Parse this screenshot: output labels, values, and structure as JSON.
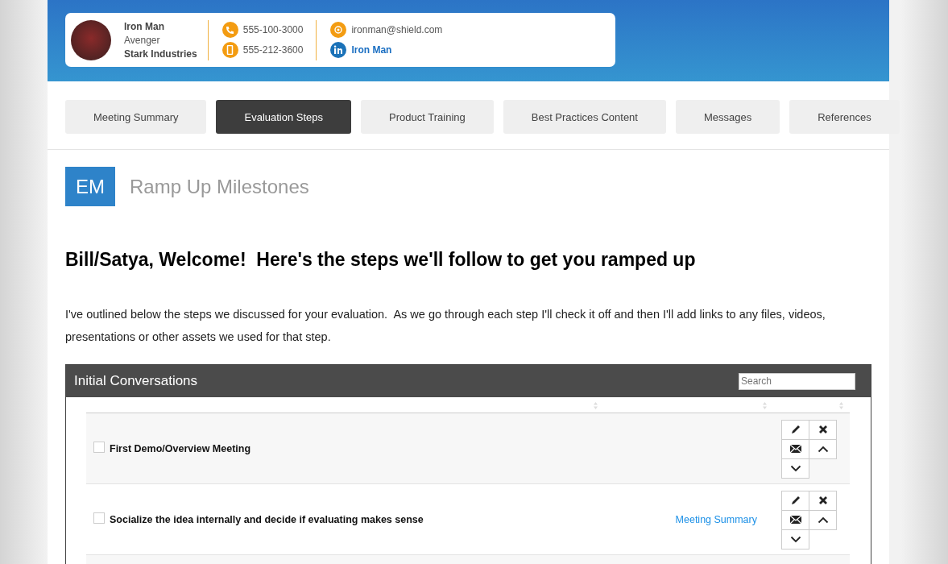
{
  "contact": {
    "name": "Iron Man",
    "title": "Avenger",
    "company": "Stark Industries",
    "phone": "555-100-3000",
    "mobile": "555-212-3600",
    "email": "ironman@shield.com",
    "linkedin": "Iron Man"
  },
  "tabs": [
    {
      "label": "Meeting Summary",
      "selected": false
    },
    {
      "label": "Evaluation Steps",
      "selected": true
    },
    {
      "label": "Product Training",
      "selected": false
    },
    {
      "label": "Best Practices Content",
      "selected": false
    },
    {
      "label": "Messages",
      "selected": false
    },
    {
      "label": "References",
      "selected": false
    }
  ],
  "page": {
    "badge": "EM",
    "title": "Ramp Up Milestones",
    "heading": "Bill/Satya, Welcome!  Here's the steps we'll follow to get you ramped up",
    "intro": "I've outlined below the steps we discussed for your evaluation.  As we go through each step I'll check it off and then I'll add links to any files, videos, presentations or other assets we used for that step."
  },
  "section": {
    "title": "Initial Conversations",
    "search": {
      "placeholder": "Search"
    },
    "steps": [
      {
        "label": "First Demo/Overview Meeting",
        "checked": false
      },
      {
        "label": "Socialize the idea internally and decide if evaluating makes sense",
        "checked": false,
        "link": "Meeting Summary"
      }
    ]
  }
}
